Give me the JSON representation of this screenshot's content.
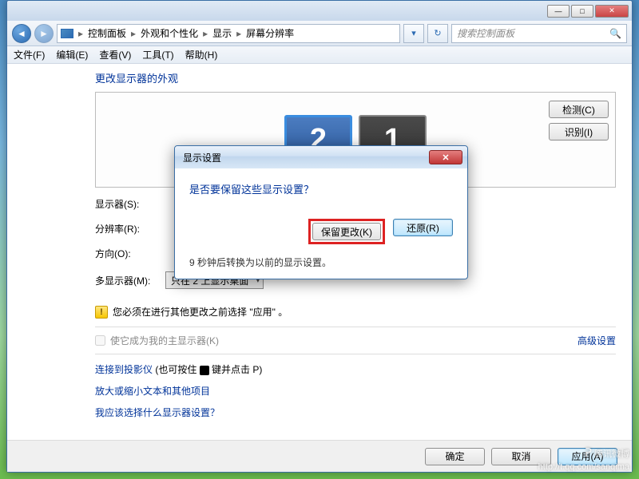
{
  "titlebar": {
    "min": "—",
    "max": "□",
    "close": "✕"
  },
  "nav": {
    "back": "◄",
    "fwd": "►",
    "crumb1": "控制面板",
    "crumb2": "外观和个性化",
    "crumb3": "显示",
    "crumb4": "屏幕分辨率",
    "sep": "▸",
    "refresh": "↻",
    "search_placeholder": "搜索控制面板"
  },
  "menu": {
    "file": "文件(F)",
    "edit": "编辑(E)",
    "view": "查看(V)",
    "tools": "工具(T)",
    "help": "帮助(H)"
  },
  "page": {
    "title": "更改显示器的外观",
    "monitor1": "1",
    "monitor2": "2",
    "detect": "检测(C)",
    "identify": "识别(I)",
    "label_display": "显示器(S):",
    "label_resolution": "分辨率(R):",
    "label_orientation": "方向(O):",
    "label_multi": "多显示器(M):",
    "multi_value": "只在 2 上显示桌面",
    "warning": "您必须在进行其他更改之前选择 \"应用\" 。",
    "primary_chk": "使它成为我的主显示器(K)",
    "advanced": "高级设置",
    "link_projector_pre": "连接到投影仪",
    "link_projector_post": " (也可按住 ",
    "link_projector_tail": " 键并点击 P)",
    "link_textsize": "放大或缩小文本和其他项目",
    "link_which": "我应该选择什么显示器设置？"
  },
  "footer": {
    "ok": "确定",
    "cancel": "取消",
    "apply": "应用(A)"
  },
  "dialog": {
    "title": "显示设置",
    "heading": "是否要保留这些显示设置？",
    "keep": "保留更改(K)",
    "revert": "还原(R)",
    "countdown": "9 秒钟后转换为以前的显示设置。"
  },
  "watermark": {
    "brand": "腾讯微博",
    "url": "http://t.qq.com/sanqima"
  }
}
